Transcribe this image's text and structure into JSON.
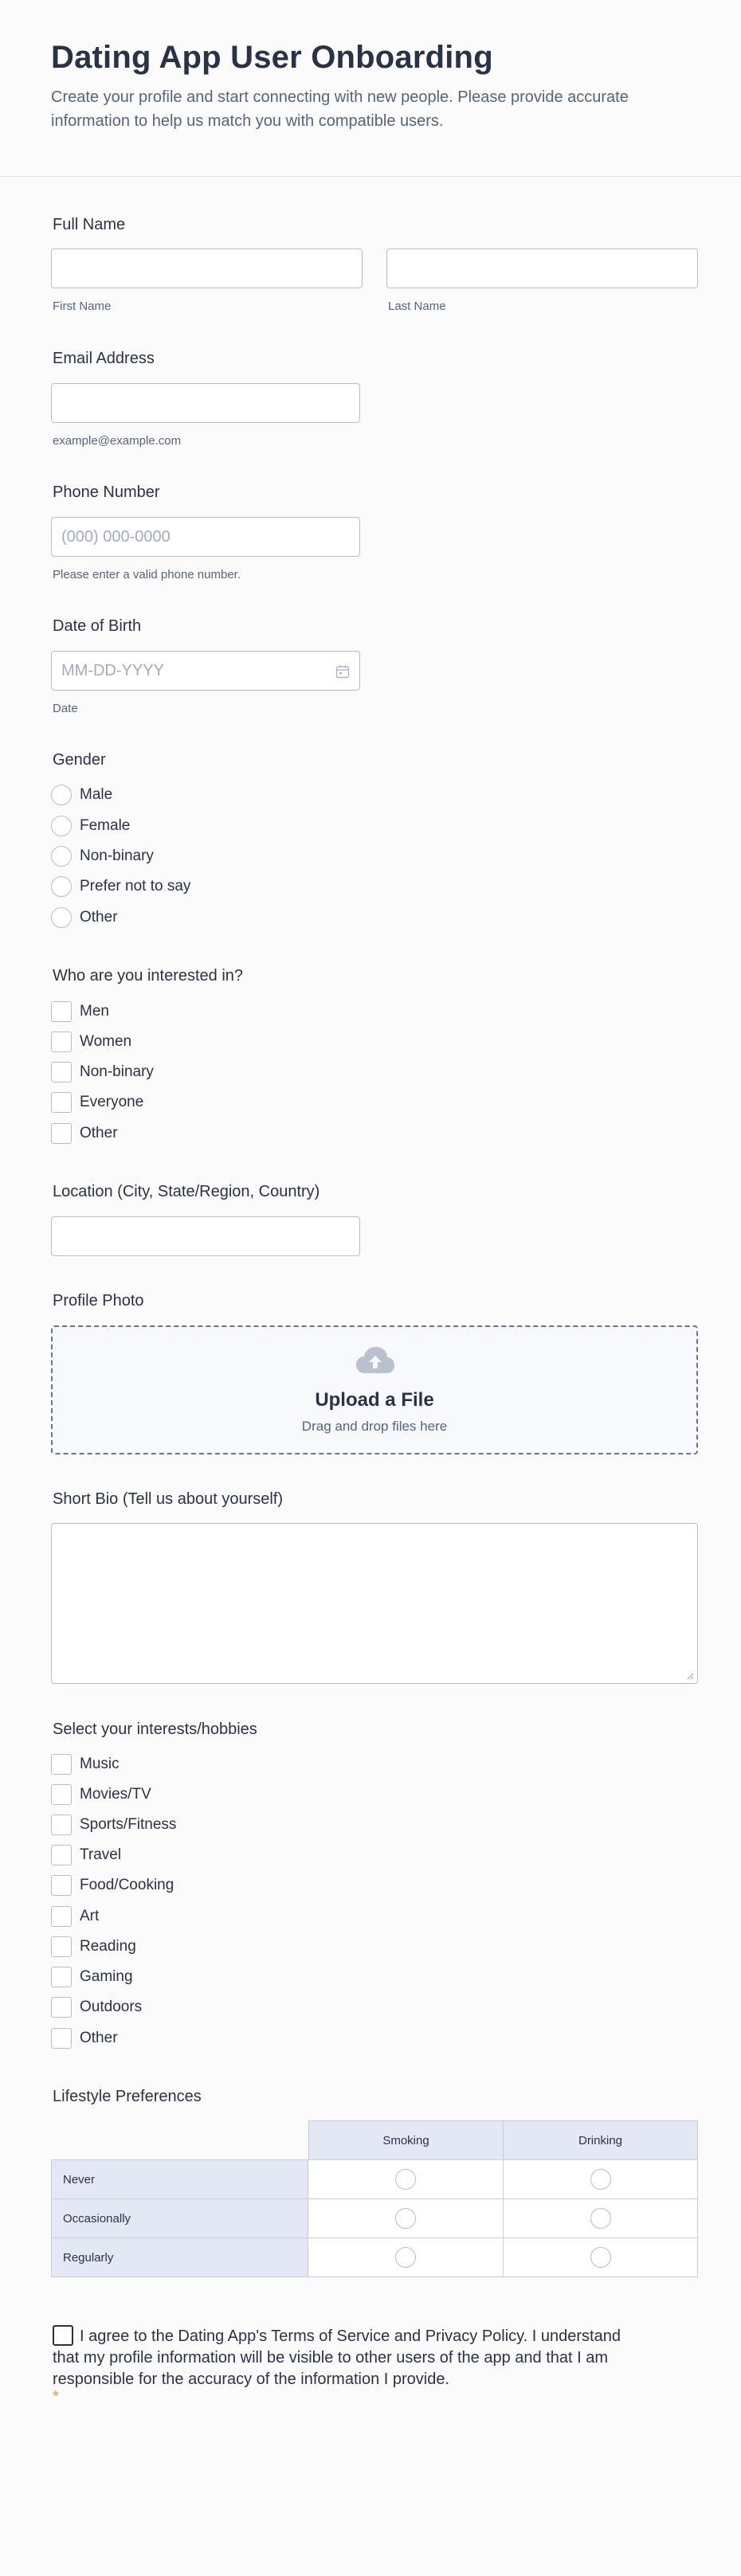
{
  "header": {
    "title": "Dating App User Onboarding",
    "description": "Create your profile and start connecting with new people. Please provide accurate information to help us match you with compatible users."
  },
  "full_name": {
    "label": "Full Name",
    "first_sub": "First Name",
    "last_sub": "Last Name",
    "first_value": "",
    "last_value": ""
  },
  "email": {
    "label": "Email Address",
    "value": "",
    "sub": "example@example.com"
  },
  "phone": {
    "label": "Phone Number",
    "placeholder": "(000) 000-0000",
    "sub": "Please enter a valid phone number."
  },
  "dob": {
    "label": "Date of Birth",
    "placeholder": "MM-DD-YYYY",
    "sub": "Date",
    "icon": "calendar-icon"
  },
  "gender": {
    "label": "Gender",
    "options": [
      "Male",
      "Female",
      "Non-binary",
      "Prefer not to say",
      "Other"
    ]
  },
  "interested_in": {
    "label": "Who are you interested in?",
    "options": [
      "Men",
      "Women",
      "Non-binary",
      "Everyone",
      "Other"
    ]
  },
  "location": {
    "label": "Location (City, State/Region, Country)",
    "value": ""
  },
  "photo": {
    "label": "Profile Photo",
    "upload_title": "Upload a File",
    "upload_hint": "Drag and drop files here",
    "icon": "cloud-upload-icon"
  },
  "bio": {
    "label": "Short Bio (Tell us about yourself)",
    "value": ""
  },
  "interests": {
    "label": "Select your interests/hobbies",
    "options": [
      "Music",
      "Movies/TV",
      "Sports/Fitness",
      "Travel",
      "Food/Cooking",
      "Art",
      "Reading",
      "Gaming",
      "Outdoors",
      "Other"
    ]
  },
  "lifestyle": {
    "label": "Lifestyle Preferences",
    "columns": [
      "Smoking",
      "Drinking"
    ],
    "rows": [
      "Never",
      "Occasionally",
      "Regularly"
    ]
  },
  "terms": {
    "text": "I agree to the Dating App's Terms of Service and Privacy Policy. I understand that my profile information will be visible to other users of the app and that I am responsible for the accuracy of the information I provide.",
    "required_mark": "*"
  },
  "colors": {
    "text": "#2b3245",
    "muted": "#57647e",
    "border": "#b8bdc9",
    "matrix_header": "#e4e8f4",
    "required": "#f0973f"
  }
}
